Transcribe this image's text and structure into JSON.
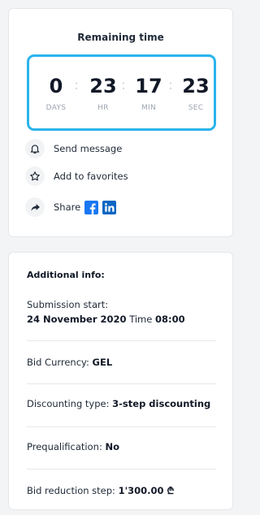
{
  "timer": {
    "title": "Remaining time",
    "accent_color": "#2ab4ec",
    "separator": ":",
    "units": [
      {
        "value": "0",
        "label": "DAYS"
      },
      {
        "value": "23",
        "label": "HR"
      },
      {
        "value": "17",
        "label": "MIN"
      },
      {
        "value": "23",
        "label": "SEC"
      }
    ]
  },
  "actions": [
    {
      "icon": "bell-icon",
      "label": "Send message"
    },
    {
      "icon": "star-icon",
      "label": "Add to favorites"
    },
    {
      "icon": "share-icon",
      "label": "Share"
    }
  ],
  "social": {
    "facebook_icon": "facebook-icon",
    "linkedin_icon": "linkedin-icon",
    "facebook_color": "#1877f2",
    "linkedin_color": "#0a66c2"
  },
  "info": {
    "title": "Additional info:",
    "submission_label": "Submission start:",
    "submission_date": "24 November 2020",
    "time_label": "Time",
    "time_value": "08:00",
    "currency_label": "Bid Currency:",
    "currency_value": "GEL",
    "discounting_label": "Discounting type:",
    "discounting_value": "3-step discounting",
    "prequal_label": "Prequalification:",
    "prequal_value": "No",
    "reduction_label": "Bid reduction step:",
    "reduction_value": "1'300.00 ₾"
  }
}
